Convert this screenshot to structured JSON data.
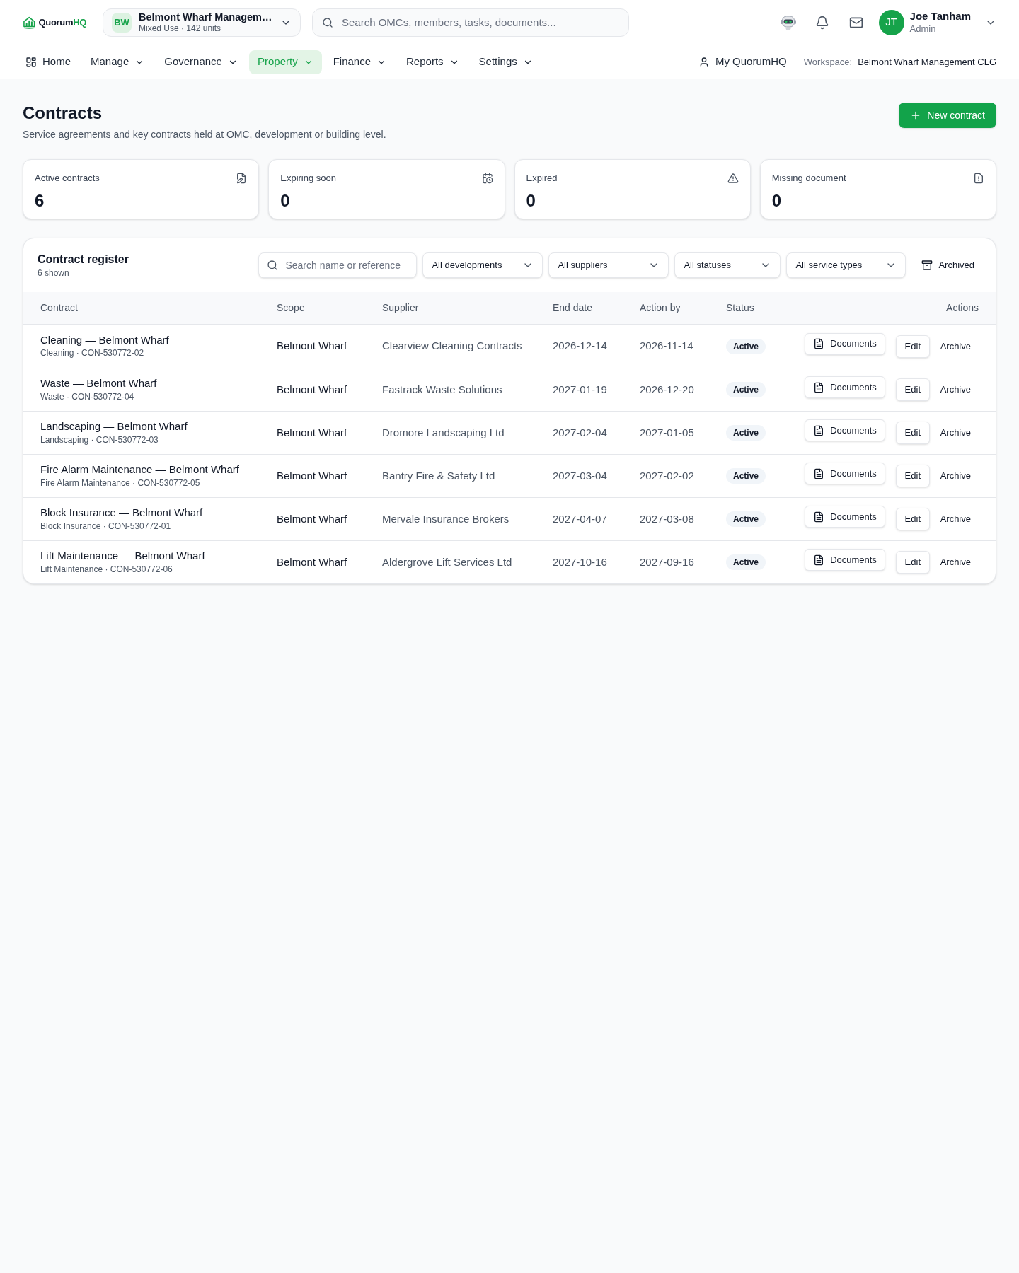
{
  "header": {
    "logo": {
      "text": "Quorum",
      "accent": "HQ"
    },
    "workspace": {
      "initials": "BW",
      "name": "Belmont Wharf Managem…",
      "detail": "Mixed Use · 142 units"
    },
    "search": {
      "placeholder": "Search OMCs, members, tasks, documents..."
    },
    "user": {
      "initials": "JT",
      "name": "Joe Tanham",
      "role": "Admin"
    }
  },
  "nav": {
    "items": [
      {
        "label": "Home",
        "kind": "link",
        "selected": false
      },
      {
        "label": "Manage",
        "kind": "menu",
        "selected": false
      },
      {
        "label": "Governance",
        "kind": "menu",
        "selected": false
      },
      {
        "label": "Property",
        "kind": "menu",
        "selected": true
      },
      {
        "label": "Finance",
        "kind": "menu",
        "selected": false
      },
      {
        "label": "Reports",
        "kind": "menu",
        "selected": false
      },
      {
        "label": "Settings",
        "kind": "menu",
        "selected": false
      }
    ],
    "account_link": "My QuorumHQ",
    "workspace_label": "Workspace:",
    "workspace_name": "Belmont Wharf Management CLG"
  },
  "page": {
    "title": "Contracts",
    "subtitle": "Service agreements and key contracts held at OMC, development or building level.",
    "new_button": "New contract"
  },
  "stats": [
    {
      "label": "Active contracts",
      "value": "6"
    },
    {
      "label": "Expiring soon",
      "value": "0"
    },
    {
      "label": "Expired",
      "value": "0"
    },
    {
      "label": "Missing document",
      "value": "0"
    }
  ],
  "register": {
    "title": "Contract register",
    "count": "6 shown",
    "search": {
      "placeholder": "Search name or reference"
    },
    "filters": [
      "All developments",
      "All suppliers",
      "All statuses",
      "All service types"
    ],
    "archived_button": "Archived",
    "columns": [
      "Contract",
      "Scope",
      "Supplier",
      "End date",
      "Action by",
      "Status",
      "Actions"
    ],
    "rows": [
      {
        "name": "Cleaning — Belmont Wharf",
        "meta": "Cleaning · CON-530772-02",
        "scope": "Belmont Wharf",
        "supplier": "Clearview Cleaning Contracts",
        "end_date": "2026-12-14",
        "action_by": "2026-11-14",
        "status": "Active",
        "actions": {
          "documents": "Documents",
          "edit": "Edit",
          "archive": "Archive"
        }
      },
      {
        "name": "Waste — Belmont Wharf",
        "meta": "Waste · CON-530772-04",
        "scope": "Belmont Wharf",
        "supplier": "Fastrack Waste Solutions",
        "end_date": "2027-01-19",
        "action_by": "2026-12-20",
        "status": "Active",
        "actions": {
          "documents": "Documents",
          "edit": "Edit",
          "archive": "Archive"
        }
      },
      {
        "name": "Landscaping — Belmont Wharf",
        "meta": "Landscaping · CON-530772-03",
        "scope": "Belmont Wharf",
        "supplier": "Dromore Landscaping Ltd",
        "end_date": "2027-02-04",
        "action_by": "2027-01-05",
        "status": "Active",
        "actions": {
          "documents": "Documents",
          "edit": "Edit",
          "archive": "Archive"
        }
      },
      {
        "name": "Fire Alarm Maintenance — Belmont Wharf",
        "meta": "Fire Alarm Maintenance · CON-530772-05",
        "scope": "Belmont Wharf",
        "supplier": "Bantry Fire & Safety Ltd",
        "end_date": "2027-03-04",
        "action_by": "2027-02-02",
        "status": "Active",
        "actions": {
          "documents": "Documents",
          "edit": "Edit",
          "archive": "Archive"
        }
      },
      {
        "name": "Block Insurance — Belmont Wharf",
        "meta": "Block Insurance · CON-530772-01",
        "scope": "Belmont Wharf",
        "supplier": "Mervale Insurance Brokers",
        "end_date": "2027-04-07",
        "action_by": "2027-03-08",
        "status": "Active",
        "actions": {
          "documents": "Documents",
          "edit": "Edit",
          "archive": "Archive"
        }
      },
      {
        "name": "Lift Maintenance — Belmont Wharf",
        "meta": "Lift Maintenance · CON-530772-06",
        "scope": "Belmont Wharf",
        "supplier": "Aldergrove Lift Services Ltd",
        "end_date": "2027-10-16",
        "action_by": "2027-09-16",
        "status": "Active",
        "actions": {
          "documents": "Documents",
          "edit": "Edit",
          "archive": "Archive"
        }
      }
    ]
  }
}
